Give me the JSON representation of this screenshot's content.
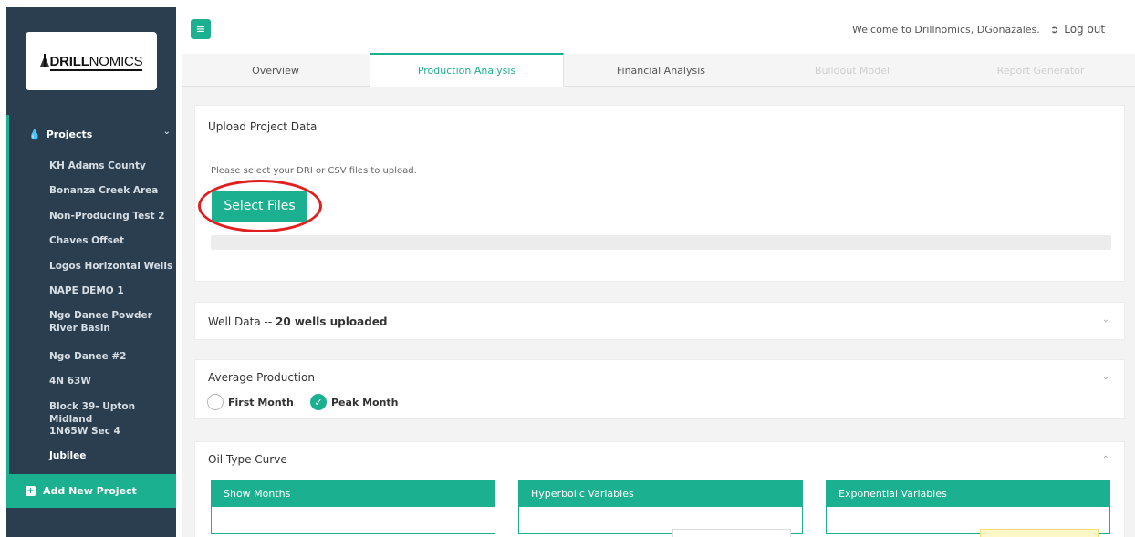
{
  "brand": {
    "logo_text_prefix": "",
    "logo_text_bold": "DRILL",
    "logo_text_rest": "NOMICS"
  },
  "sidebar": {
    "section_label": "Projects",
    "projects": [
      "KH Adams County",
      "Bonanza Creek Area",
      "Non-Producing Test 2",
      "Chaves Offset",
      "Logos Horizontal Wells",
      "NAPE DEMO 1",
      "Ngo Danee Powder River Basin",
      "Ngo Danee #2",
      "4N 63W",
      "Block 39- Upton Midland",
      "1N65W Sec 4",
      "Jubilee"
    ],
    "active_project": "Jubilee",
    "add_project_label": "Add New Project"
  },
  "header": {
    "menu_icon": "hamburger-icon",
    "welcome": "Welcome to Drillnomics, DGonazales.",
    "logout_label": "Log out"
  },
  "tabs": [
    {
      "label": "Overview",
      "state": "normal"
    },
    {
      "label": "Production Analysis",
      "state": "active"
    },
    {
      "label": "Financial Analysis",
      "state": "normal"
    },
    {
      "label": "Buildout Model",
      "state": "disabled"
    },
    {
      "label": "Report Generator",
      "state": "disabled"
    }
  ],
  "upload": {
    "title": "Upload Project Data",
    "instructions": "Please select your DRI or CSV files to upload.",
    "button_label": "Select Files"
  },
  "well_data": {
    "prefix": "Well Data -- ",
    "bold": "20 wells uploaded"
  },
  "average_production": {
    "title": "Average Production",
    "options": [
      "First Month",
      "Peak Month"
    ],
    "selected": "Peak Month"
  },
  "oil_type_curve": {
    "title": "Oil Type Curve",
    "sub_panels": [
      "Show Months",
      "Hyperbolic Variables",
      "Exponential Variables"
    ]
  },
  "colors": {
    "accent": "#1bb08f",
    "sidebar": "#2b3e50",
    "highlight": "#e02020"
  }
}
